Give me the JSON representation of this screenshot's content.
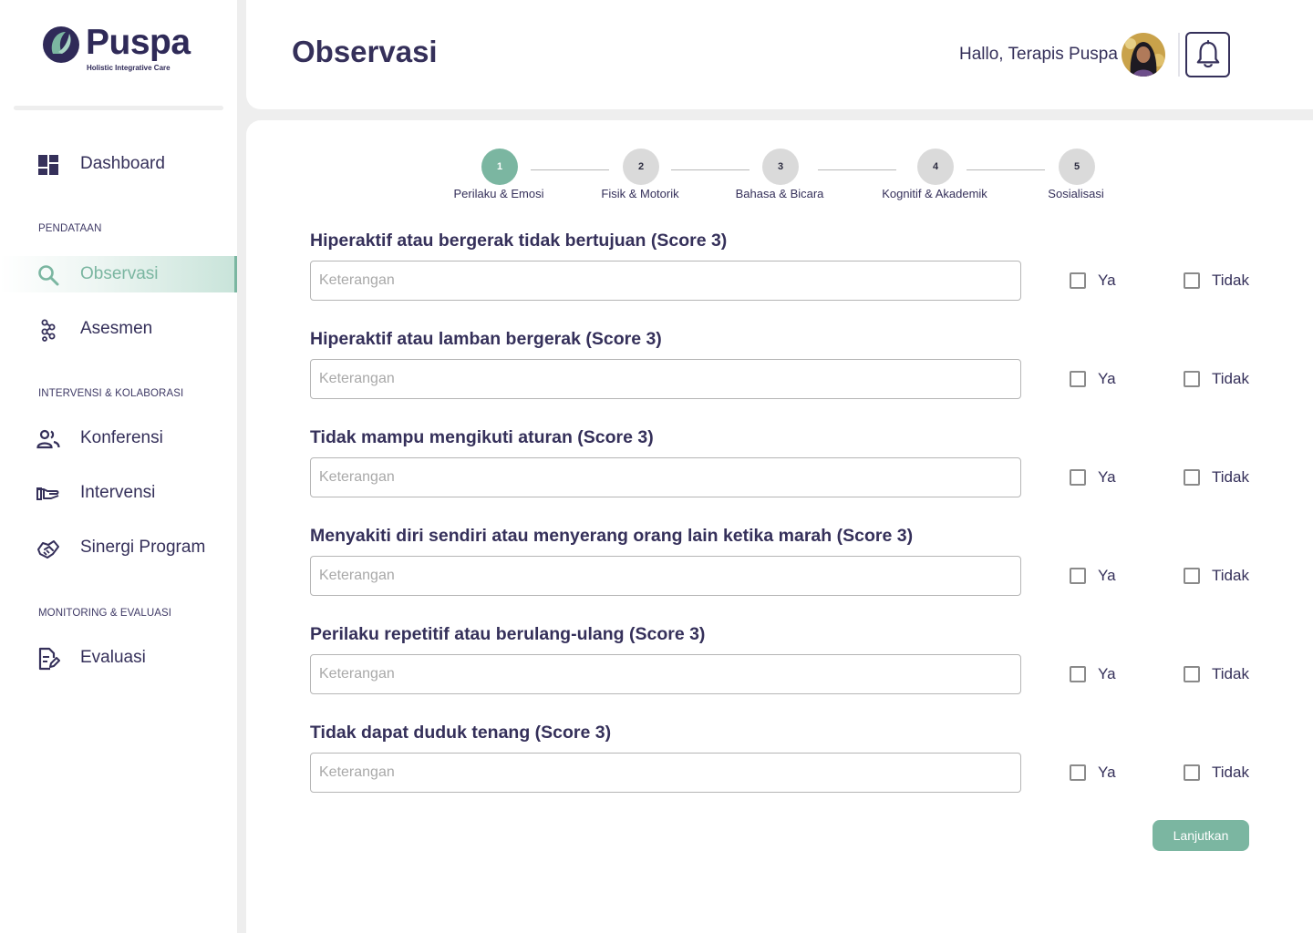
{
  "brand": {
    "name": "Puspa",
    "tagline": "Holistic Integrative Care"
  },
  "sidebar": {
    "dashboard": {
      "label": "Dashboard",
      "icon": "dashboard-icon"
    },
    "sections": [
      {
        "title": "PENDATAAN"
      },
      {
        "title": "INTERVENSI & KOLABORASI"
      },
      {
        "title": "MONITORING & EVALUASI"
      }
    ],
    "items": [
      {
        "label": "Observasi",
        "icon": "search-icon",
        "active": true
      },
      {
        "label": "Asesmen",
        "icon": "dna-icon"
      },
      {
        "label": "Konferensi",
        "icon": "people-icon"
      },
      {
        "label": "Intervensi",
        "icon": "hand-icon"
      },
      {
        "label": "Sinergi Program",
        "icon": "handshake-icon"
      },
      {
        "label": "Evaluasi",
        "icon": "document-edit-icon"
      }
    ]
  },
  "header": {
    "title": "Observasi",
    "greeting": "Hallo, Terapis Puspa",
    "bell_icon": "bell-icon"
  },
  "stepper": [
    {
      "number": "1",
      "label": "Perilaku & Emosi",
      "active": true
    },
    {
      "number": "2",
      "label": "Fisik & Motorik"
    },
    {
      "number": "3",
      "label": "Bahasa & Bicara"
    },
    {
      "number": "4",
      "label": "Kognitif & Akademik"
    },
    {
      "number": "5",
      "label": "Sosialisasi"
    }
  ],
  "questions": [
    {
      "title": "Hiperaktif atau bergerak tidak bertujuan (Score 3)",
      "value": ""
    },
    {
      "title": "Hiperaktif atau lamban bergerak (Score 3)",
      "value": ""
    },
    {
      "title": "Tidak mampu mengikuti aturan (Score 3)",
      "value": ""
    },
    {
      "title": "Menyakiti diri sendiri atau menyerang orang lain ketika marah (Score 3)",
      "value": ""
    },
    {
      "title": "Perilaku repetitif atau berulang-ulang (Score 3)",
      "value": ""
    },
    {
      "title": "Tidak dapat duduk tenang (Score 3)",
      "value": ""
    }
  ],
  "form": {
    "placeholder": "Keterangan",
    "yes_label": "Ya",
    "no_label": "Tidak",
    "next_label": "Lanjutkan"
  },
  "colors": {
    "accent": "#7bb6a1",
    "text": "#35305a",
    "background": "#eeeeee"
  }
}
